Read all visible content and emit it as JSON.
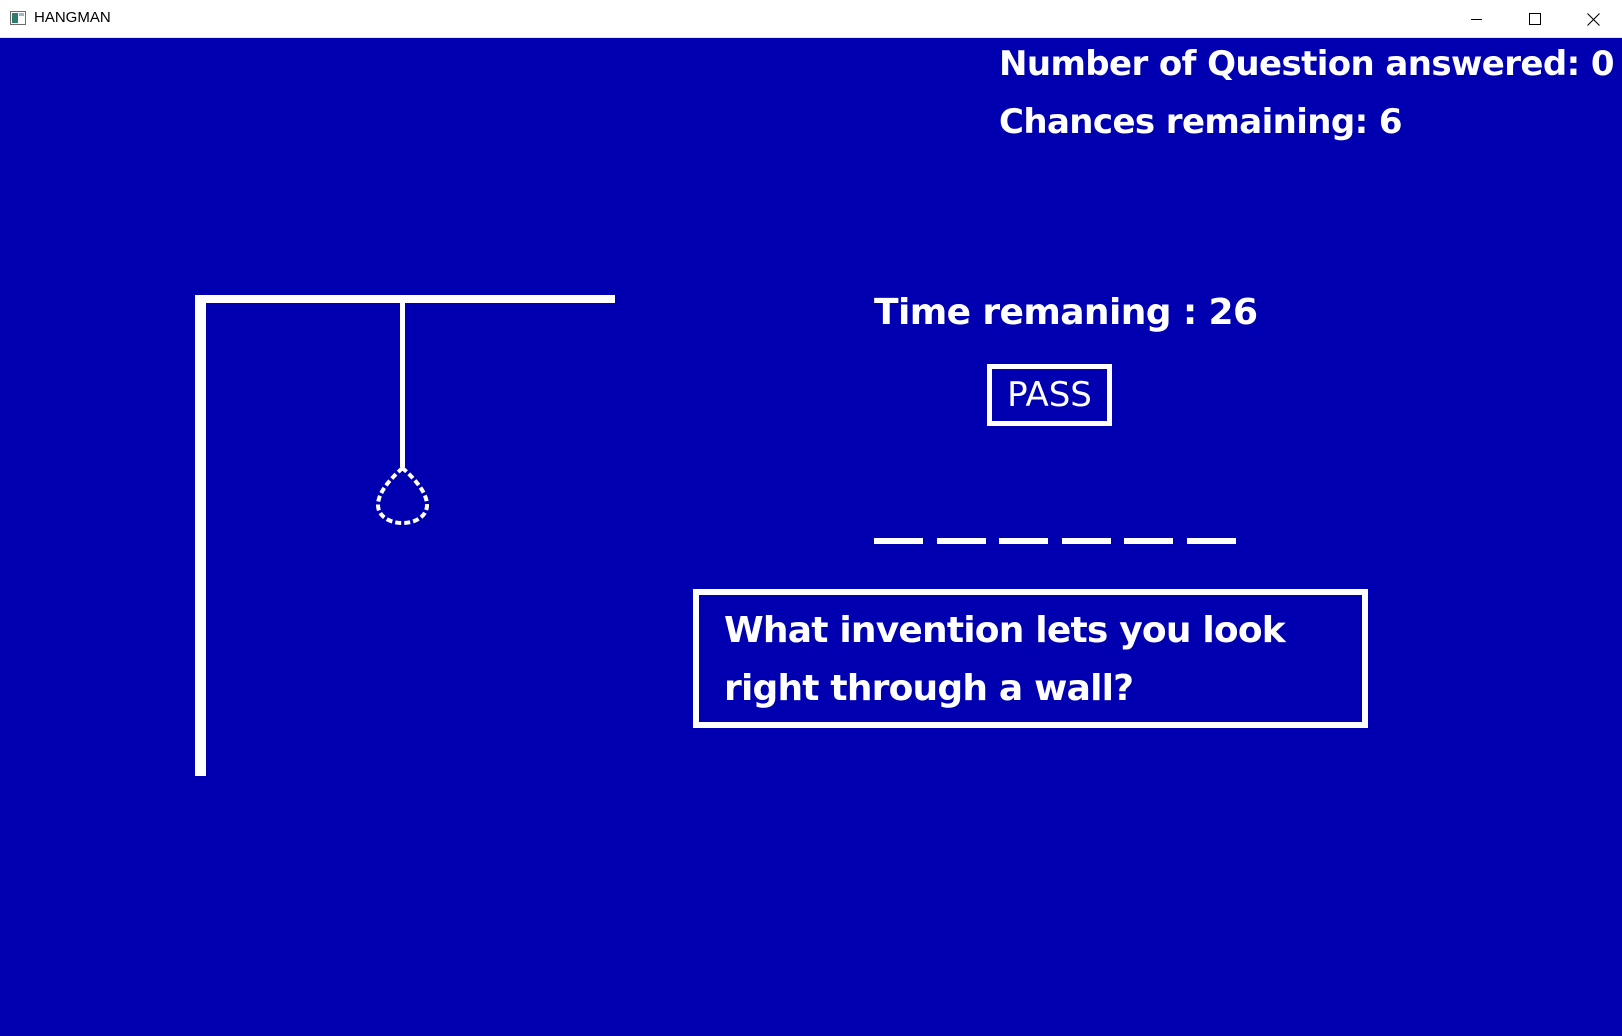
{
  "window": {
    "title": "HANGMAN",
    "icons": {
      "app": "window-app-icon",
      "minimize": "minimize-icon",
      "maximize": "maximize-icon",
      "close": "close-icon"
    }
  },
  "game": {
    "background_color": "#0000b0",
    "foreground_color": "#ffffff",
    "answered_text": "Number of Question answered: 0",
    "chances_text": "Chances remaining: 6",
    "timer_text": "Time remaning : 26",
    "pass_label": "PASS",
    "word_blank_count": 6,
    "question": "What invention lets you look right through a wall?"
  }
}
